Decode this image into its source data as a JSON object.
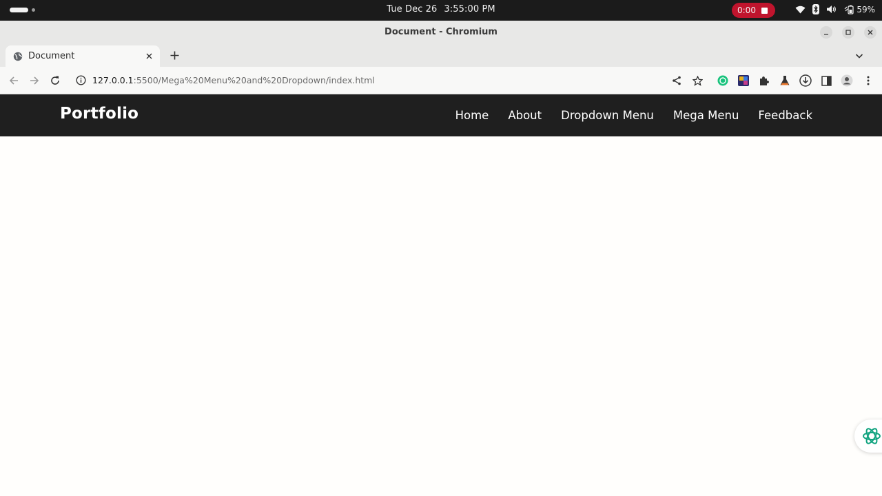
{
  "system": {
    "date": "Tue Dec 26",
    "time": "3:55:00 PM",
    "recording_time": "0:00",
    "battery": "59%"
  },
  "window": {
    "title": "Document - Chromium"
  },
  "tabs": [
    {
      "label": "Document",
      "active": true
    }
  ],
  "toolbar": {
    "url_host": "127.0.0.1",
    "url_path": ":5500/Mega%20Menu%20and%20Dropdown/index.html"
  },
  "site": {
    "brand": "Portfolio",
    "nav": [
      {
        "label": "Home"
      },
      {
        "label": "About"
      },
      {
        "label": "Dropdown Menu"
      },
      {
        "label": "Mega Menu"
      },
      {
        "label": "Feedback"
      }
    ]
  },
  "colors": {
    "navbar_bg": "#1f1f1f",
    "record_badge": "#c0142d",
    "assistant_accent": "#10a37f"
  }
}
